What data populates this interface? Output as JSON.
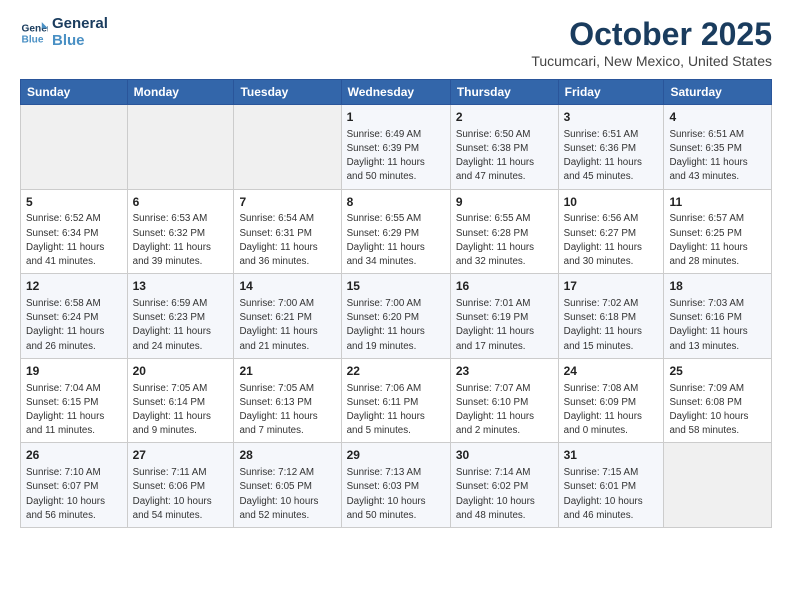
{
  "header": {
    "logo_line1": "General",
    "logo_line2": "Blue",
    "title": "October 2025",
    "subtitle": "Tucumcari, New Mexico, United States"
  },
  "columns": [
    "Sunday",
    "Monday",
    "Tuesday",
    "Wednesday",
    "Thursday",
    "Friday",
    "Saturday"
  ],
  "weeks": [
    [
      {
        "day": "",
        "info": ""
      },
      {
        "day": "",
        "info": ""
      },
      {
        "day": "",
        "info": ""
      },
      {
        "day": "1",
        "info": "Sunrise: 6:49 AM\nSunset: 6:39 PM\nDaylight: 11 hours\nand 50 minutes."
      },
      {
        "day": "2",
        "info": "Sunrise: 6:50 AM\nSunset: 6:38 PM\nDaylight: 11 hours\nand 47 minutes."
      },
      {
        "day": "3",
        "info": "Sunrise: 6:51 AM\nSunset: 6:36 PM\nDaylight: 11 hours\nand 45 minutes."
      },
      {
        "day": "4",
        "info": "Sunrise: 6:51 AM\nSunset: 6:35 PM\nDaylight: 11 hours\nand 43 minutes."
      }
    ],
    [
      {
        "day": "5",
        "info": "Sunrise: 6:52 AM\nSunset: 6:34 PM\nDaylight: 11 hours\nand 41 minutes."
      },
      {
        "day": "6",
        "info": "Sunrise: 6:53 AM\nSunset: 6:32 PM\nDaylight: 11 hours\nand 39 minutes."
      },
      {
        "day": "7",
        "info": "Sunrise: 6:54 AM\nSunset: 6:31 PM\nDaylight: 11 hours\nand 36 minutes."
      },
      {
        "day": "8",
        "info": "Sunrise: 6:55 AM\nSunset: 6:29 PM\nDaylight: 11 hours\nand 34 minutes."
      },
      {
        "day": "9",
        "info": "Sunrise: 6:55 AM\nSunset: 6:28 PM\nDaylight: 11 hours\nand 32 minutes."
      },
      {
        "day": "10",
        "info": "Sunrise: 6:56 AM\nSunset: 6:27 PM\nDaylight: 11 hours\nand 30 minutes."
      },
      {
        "day": "11",
        "info": "Sunrise: 6:57 AM\nSunset: 6:25 PM\nDaylight: 11 hours\nand 28 minutes."
      }
    ],
    [
      {
        "day": "12",
        "info": "Sunrise: 6:58 AM\nSunset: 6:24 PM\nDaylight: 11 hours\nand 26 minutes."
      },
      {
        "day": "13",
        "info": "Sunrise: 6:59 AM\nSunset: 6:23 PM\nDaylight: 11 hours\nand 24 minutes."
      },
      {
        "day": "14",
        "info": "Sunrise: 7:00 AM\nSunset: 6:21 PM\nDaylight: 11 hours\nand 21 minutes."
      },
      {
        "day": "15",
        "info": "Sunrise: 7:00 AM\nSunset: 6:20 PM\nDaylight: 11 hours\nand 19 minutes."
      },
      {
        "day": "16",
        "info": "Sunrise: 7:01 AM\nSunset: 6:19 PM\nDaylight: 11 hours\nand 17 minutes."
      },
      {
        "day": "17",
        "info": "Sunrise: 7:02 AM\nSunset: 6:18 PM\nDaylight: 11 hours\nand 15 minutes."
      },
      {
        "day": "18",
        "info": "Sunrise: 7:03 AM\nSunset: 6:16 PM\nDaylight: 11 hours\nand 13 minutes."
      }
    ],
    [
      {
        "day": "19",
        "info": "Sunrise: 7:04 AM\nSunset: 6:15 PM\nDaylight: 11 hours\nand 11 minutes."
      },
      {
        "day": "20",
        "info": "Sunrise: 7:05 AM\nSunset: 6:14 PM\nDaylight: 11 hours\nand 9 minutes."
      },
      {
        "day": "21",
        "info": "Sunrise: 7:05 AM\nSunset: 6:13 PM\nDaylight: 11 hours\nand 7 minutes."
      },
      {
        "day": "22",
        "info": "Sunrise: 7:06 AM\nSunset: 6:11 PM\nDaylight: 11 hours\nand 5 minutes."
      },
      {
        "day": "23",
        "info": "Sunrise: 7:07 AM\nSunset: 6:10 PM\nDaylight: 11 hours\nand 2 minutes."
      },
      {
        "day": "24",
        "info": "Sunrise: 7:08 AM\nSunset: 6:09 PM\nDaylight: 11 hours\nand 0 minutes."
      },
      {
        "day": "25",
        "info": "Sunrise: 7:09 AM\nSunset: 6:08 PM\nDaylight: 10 hours\nand 58 minutes."
      }
    ],
    [
      {
        "day": "26",
        "info": "Sunrise: 7:10 AM\nSunset: 6:07 PM\nDaylight: 10 hours\nand 56 minutes."
      },
      {
        "day": "27",
        "info": "Sunrise: 7:11 AM\nSunset: 6:06 PM\nDaylight: 10 hours\nand 54 minutes."
      },
      {
        "day": "28",
        "info": "Sunrise: 7:12 AM\nSunset: 6:05 PM\nDaylight: 10 hours\nand 52 minutes."
      },
      {
        "day": "29",
        "info": "Sunrise: 7:13 AM\nSunset: 6:03 PM\nDaylight: 10 hours\nand 50 minutes."
      },
      {
        "day": "30",
        "info": "Sunrise: 7:14 AM\nSunset: 6:02 PM\nDaylight: 10 hours\nand 48 minutes."
      },
      {
        "day": "31",
        "info": "Sunrise: 7:15 AM\nSunset: 6:01 PM\nDaylight: 10 hours\nand 46 minutes."
      },
      {
        "day": "",
        "info": ""
      }
    ]
  ]
}
